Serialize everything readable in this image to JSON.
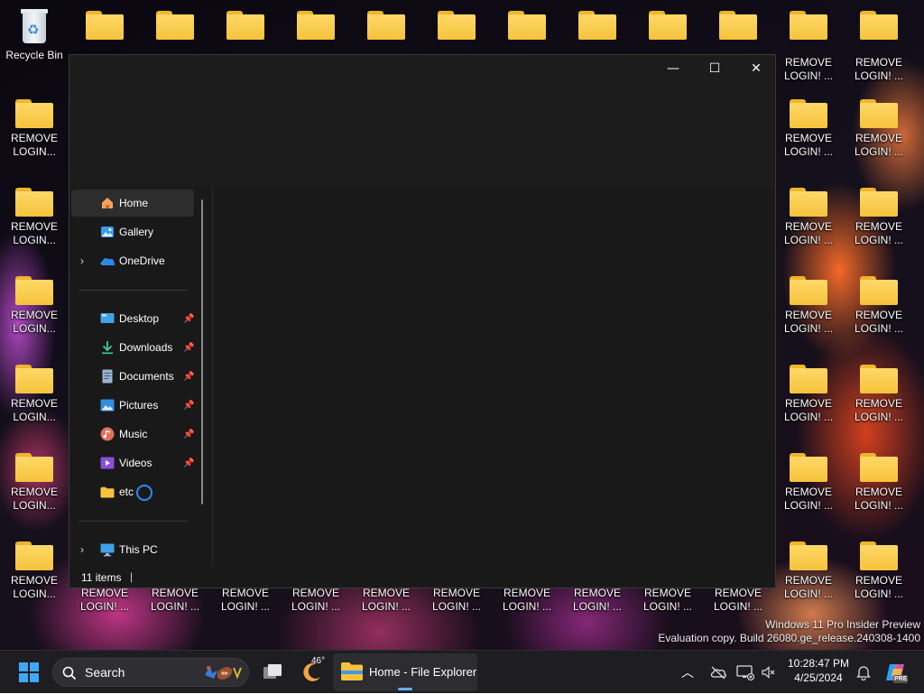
{
  "desktop": {
    "recycle_bin_label": "Recycle Bin",
    "folder_label_two_line": "REMOVE\nLOGIN...",
    "folder_label_excl": "REMOVE\nLOGIN! ...",
    "watermark_line1": "Windows 11 Pro Insider Preview",
    "watermark_line2": "Evaluation copy. Build 26080.ge_release.240308-1400"
  },
  "window": {
    "minimize_glyph": "—",
    "maximize_glyph": "☐",
    "close_glyph": "✕"
  },
  "nav": {
    "items": [
      {
        "label": "Home",
        "icon": "home-icon"
      },
      {
        "label": "Gallery",
        "icon": "gallery-icon"
      },
      {
        "label": "OneDrive",
        "icon": "onedrive-icon"
      },
      {
        "label": "Desktop",
        "icon": "desktop-icon",
        "pinned": true
      },
      {
        "label": "Downloads",
        "icon": "downloads-icon",
        "pinned": true
      },
      {
        "label": "Documents",
        "icon": "documents-icon",
        "pinned": true
      },
      {
        "label": "Pictures",
        "icon": "pictures-icon",
        "pinned": true
      },
      {
        "label": "Music",
        "icon": "music-icon",
        "pinned": true
      },
      {
        "label": "Videos",
        "icon": "videos-icon",
        "pinned": true
      },
      {
        "label": "etc",
        "icon": "folder-icon"
      },
      {
        "label": "This PC",
        "icon": "this-pc-icon"
      }
    ],
    "selected": "Home"
  },
  "status": {
    "item_count": "11 items",
    "separator": "|"
  },
  "taskbar": {
    "search_label": "Search",
    "weather_temp": "46°",
    "active_app_label": "Home - File Explorer",
    "time": "10:28:47 PM",
    "date": "4/25/2024",
    "copilot_badge": "PRE"
  },
  "colors": {
    "accent": "#60b0ff",
    "folder_yellow": "#f5c33c",
    "window_bg": "#202020",
    "taskbar_bg": "#1d1d22"
  }
}
